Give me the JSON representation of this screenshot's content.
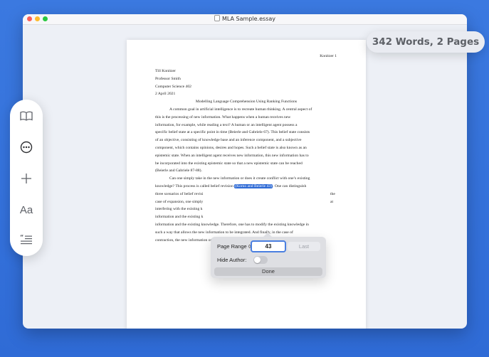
{
  "window": {
    "title": "MLA Sample.essay"
  },
  "word_count_badge": "342 Words, 2 Pages",
  "document": {
    "header_right": "Konitzer 1",
    "heading_lines": [
      "Till Konitzer",
      "Professor Smith",
      "Computer Science 402",
      "2 April 2021"
    ],
    "title": "Modelling Language Comprehension Using Ranking Functions",
    "paragraph1_lines": [
      "A common goal in artificial intelligence is to recreate human thinking. A central aspect of",
      "this is the processing of new information. What happens when a human receives new",
      "information, for example, while reading a text? A human or an intelligent agent possess a",
      "specific belief state at a specific point in time (Beierle and Gabriele 67). This belief state consists",
      "of an objective, consisting of knowledge base and an inference component, and a subjective",
      "component, which contains opinions, desires and hopes. Such a belief state is also known as an",
      "epistemic state. When an intelligent agent receives new information, this new information has to",
      "be incorporated into the existing epistemic state so that a new epistemic state can be reached",
      "(Beierle and Gabriele 87-88)."
    ],
    "paragraph2_line1": "Can one simply take in the new information or does it create conflict with one’s existing",
    "paragraph2_line2_before": "knowledge? This process is called belief revision ",
    "paragraph2_citation": "(Komo and Beierle 43)",
    "paragraph2_line2_after": ". One can distinguish",
    "paragraph2_partial_lines": [
      {
        "left": "three scenarios of belief revisi",
        "right": "the"
      },
      {
        "left": "case of expansion, one simply",
        "right": "at"
      },
      {
        "left": "interfering with the existing k",
        "right": ""
      },
      {
        "left": "information and the existing k",
        "right": ""
      }
    ],
    "paragraph2_rest_lines": [
      "information and the existing knowledge. Therefore, one has to modify the existing knowledge in",
      "such a way that allows the new information to be integrated. And finally, in the case of",
      "contraction, the new information once again creates a conflict with the existing knowledge."
    ]
  },
  "popover": {
    "range_label": "Page Range ◊",
    "range_value": "43",
    "last_label": "Last",
    "hide_author_label": "Hide Author:",
    "hide_author_on": false,
    "done_label": "Done"
  },
  "toolbar": {
    "font_label": "Aa"
  },
  "colors": {
    "accent": "#2f6bd6",
    "background": "#3b79e0"
  }
}
